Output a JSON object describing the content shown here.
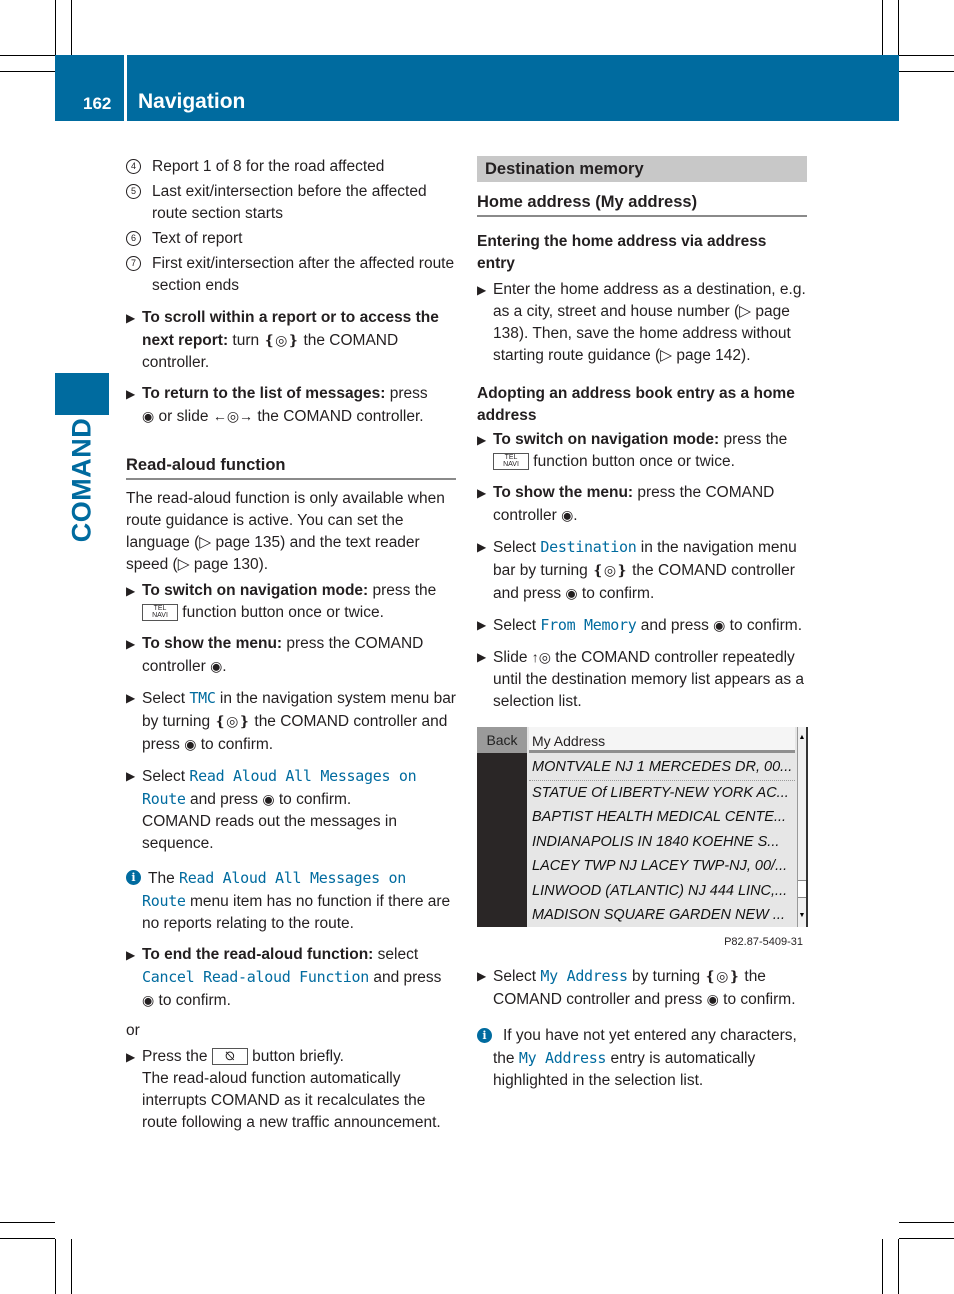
{
  "header": {
    "page_number": "162",
    "chapter_title": "Navigation"
  },
  "side_tab": {
    "label": "COMAND",
    "color": "#006b9f"
  },
  "left": {
    "numbered": [
      {
        "num": "4",
        "text": "Report 1 of 8 for the road affected"
      },
      {
        "num": "5",
        "text": "Last exit/intersection before the affected route section starts"
      },
      {
        "num": "6",
        "text": "Text of report"
      },
      {
        "num": "7",
        "text": "First exit/intersection after the affected route section ends"
      }
    ],
    "step_scroll": {
      "bold": "To scroll within a report or to access the next report:",
      "pre": " turn ",
      "post": " the COMAND controller."
    },
    "step_return": {
      "bold": "To return to the list of messages:",
      "pre": " press ",
      "mid": " or slide ",
      "post": " the COMAND controller."
    },
    "section_title": "Read-aloud function",
    "intro": "The read-aloud function is only available when route guidance is active. You can set the language (▷ page 135) and the text reader speed (▷ page 130).",
    "step_nav": {
      "bold": "To switch on navigation mode:",
      "pre": " press the ",
      "post": " function button once or twice."
    },
    "step_menu": {
      "bold": "To show the menu:",
      "pre": " press the COMAND controller ",
      "post": "."
    },
    "step_tmc": {
      "pre": "Select ",
      "mono": "TMC",
      "mid": " in the navigation system menu bar by turning ",
      "mid2": " the COMAND controller and press ",
      "post": " to confirm."
    },
    "step_readall": {
      "pre": "Select ",
      "mono": "Read Aloud All Messages on Route",
      "mid": " and press ",
      "post": " to confirm.",
      "after": "COMAND reads out the messages in sequence."
    },
    "info": {
      "pre": "The ",
      "mono": "Read Aloud All Messages on Route",
      "post": " menu item has no function if there are no reports relating to the route."
    },
    "step_end": {
      "bold": "To end the read-aloud function:",
      "pre": " select ",
      "mono": "Cancel Read-aloud Function",
      "mid": " and press ",
      "post": " to confirm."
    },
    "or": "or",
    "step_press": {
      "pre": "Press the ",
      "post": " button briefly.",
      "after": "The read-aloud function automatically interrupts COMAND as it recalculates the route following a new traffic announcement."
    }
  },
  "right": {
    "gray_title": "Destination memory",
    "h2": "Home address (My address)",
    "h3a": "Entering the home address via address entry",
    "step_enter": "Enter the home address as a destination, e.g. as a city, street and house number (▷ page 138). Then, save the home address without starting route guidance (▷ page 142).",
    "h3b": "Adopting an address book entry as a home address",
    "step_nav": {
      "bold": "To switch on navigation mode:",
      "pre": " press the ",
      "post": " function button once or twice."
    },
    "step_menu": {
      "bold": "To show the menu:",
      "pre": " press the COMAND controller ",
      "post": "."
    },
    "step_dest": {
      "pre": "Select ",
      "mono": "Destination",
      "mid": " in the navigation menu bar by turning ",
      "mid2": " the COMAND controller and press ",
      "post": " to confirm."
    },
    "step_mem": {
      "pre": "Select ",
      "mono": "From Memory",
      "mid": " and press ",
      "post": " to confirm."
    },
    "step_slide": {
      "pre": "Slide ",
      "post": " the COMAND controller repeatedly until the destination memory list appears as a selection list."
    },
    "screen": {
      "back": "Back",
      "title": "My Address",
      "rows": [
        "MONTVALE NJ 1 MERCEDES DR, 00...",
        "STATUE Of LIBERTY-NEW YORK AC...",
        "BAPTIST HEALTH MEDICAL CENTE...",
        "INDIANAPOLIS IN 1840 KOEHNE S...",
        "LACEY TWP NJ LACEY TWP-NJ, 00/...",
        "LINWOOD (ATLANTIC) NJ 444 LINC,...",
        "MADISON SQUARE GARDEN NEW ..."
      ],
      "caption": "P82.87-5409-31"
    },
    "step_myaddr": {
      "pre": "Select ",
      "mono": "My Address",
      "mid": " by turning ",
      "post": " the COMAND controller and press ",
      "post2": " to confirm."
    },
    "info": {
      "pre": "If you have not yet entered any characters, the ",
      "mono": "My Address",
      "post": " entry is automatically highlighted in the selection list."
    }
  },
  "glyphs": {
    "turn": "❴◎❵",
    "press": "◉",
    "slide_lr": "←◎→",
    "slide_up": "↑◎",
    "triangle": "▶",
    "info": "i",
    "tel": "TEL",
    "navi": "NAVI",
    "mute": "⦰"
  }
}
